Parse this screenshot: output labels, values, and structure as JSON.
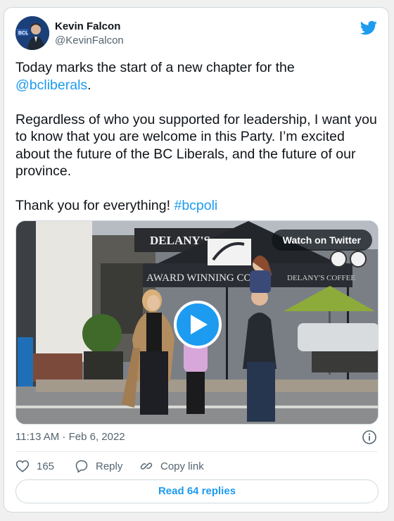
{
  "author": {
    "name": "Kevin Falcon",
    "handle": "@KevinFalcon"
  },
  "tweet": {
    "line1_text": "Today marks the start of a new chapter for the",
    "line1_mention": "@bcliberals",
    "line1_end": ".",
    "para2": "Regardless of who you supported for leadership, I want you to know that you are welcome in this Party. I’m excited about the future of the BC Liberals, and the future of our province.",
    "para3_text": "Thank you for everything!",
    "para3_hashtag": "#bcpoli"
  },
  "media": {
    "watch_label": "Watch on Twitter",
    "sign_text": "DELANY'S CO",
    "tent_text": "AWARD WINNING CO",
    "tent_text2": "DELANY'S COFFEE"
  },
  "timestamp": "11:13 AM · Feb 6, 2022",
  "actions": {
    "likes_count": "165",
    "reply_label": "Reply",
    "copy_link_label": "Copy link"
  },
  "read_replies_label": "Read 64 replies",
  "colors": {
    "accent": "#1d9bf0",
    "secondary_text": "#536471",
    "border": "#cfd9de"
  },
  "icons": [
    "twitter-bird-icon",
    "play-icon",
    "info-icon",
    "heart-icon",
    "reply-icon",
    "link-icon"
  ]
}
